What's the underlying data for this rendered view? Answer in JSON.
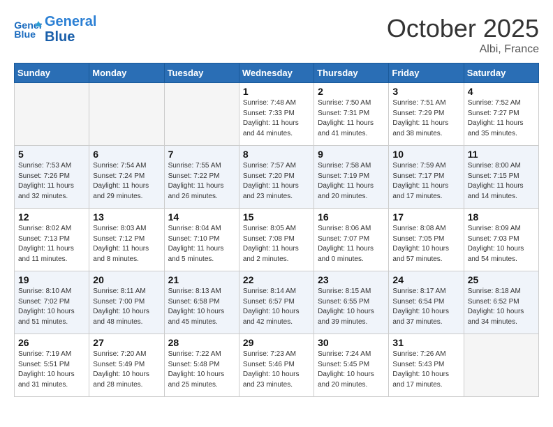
{
  "header": {
    "logo_line1": "General",
    "logo_line2": "Blue",
    "month_title": "October 2025",
    "location": "Albi, France"
  },
  "weekdays": [
    "Sunday",
    "Monday",
    "Tuesday",
    "Wednesday",
    "Thursday",
    "Friday",
    "Saturday"
  ],
  "weeks": [
    [
      {
        "day": "",
        "empty": true
      },
      {
        "day": "",
        "empty": true
      },
      {
        "day": "",
        "empty": true
      },
      {
        "day": "1",
        "sunrise": "7:48 AM",
        "sunset": "7:33 PM",
        "daylight": "11 hours and 44 minutes."
      },
      {
        "day": "2",
        "sunrise": "7:50 AM",
        "sunset": "7:31 PM",
        "daylight": "11 hours and 41 minutes."
      },
      {
        "day": "3",
        "sunrise": "7:51 AM",
        "sunset": "7:29 PM",
        "daylight": "11 hours and 38 minutes."
      },
      {
        "day": "4",
        "sunrise": "7:52 AM",
        "sunset": "7:27 PM",
        "daylight": "11 hours and 35 minutes."
      }
    ],
    [
      {
        "day": "5",
        "sunrise": "7:53 AM",
        "sunset": "7:26 PM",
        "daylight": "11 hours and 32 minutes."
      },
      {
        "day": "6",
        "sunrise": "7:54 AM",
        "sunset": "7:24 PM",
        "daylight": "11 hours and 29 minutes."
      },
      {
        "day": "7",
        "sunrise": "7:55 AM",
        "sunset": "7:22 PM",
        "daylight": "11 hours and 26 minutes."
      },
      {
        "day": "8",
        "sunrise": "7:57 AM",
        "sunset": "7:20 PM",
        "daylight": "11 hours and 23 minutes."
      },
      {
        "day": "9",
        "sunrise": "7:58 AM",
        "sunset": "7:19 PM",
        "daylight": "11 hours and 20 minutes."
      },
      {
        "day": "10",
        "sunrise": "7:59 AM",
        "sunset": "7:17 PM",
        "daylight": "11 hours and 17 minutes."
      },
      {
        "day": "11",
        "sunrise": "8:00 AM",
        "sunset": "7:15 PM",
        "daylight": "11 hours and 14 minutes."
      }
    ],
    [
      {
        "day": "12",
        "sunrise": "8:02 AM",
        "sunset": "7:13 PM",
        "daylight": "11 hours and 11 minutes."
      },
      {
        "day": "13",
        "sunrise": "8:03 AM",
        "sunset": "7:12 PM",
        "daylight": "11 hours and 8 minutes."
      },
      {
        "day": "14",
        "sunrise": "8:04 AM",
        "sunset": "7:10 PM",
        "daylight": "11 hours and 5 minutes."
      },
      {
        "day": "15",
        "sunrise": "8:05 AM",
        "sunset": "7:08 PM",
        "daylight": "11 hours and 2 minutes."
      },
      {
        "day": "16",
        "sunrise": "8:06 AM",
        "sunset": "7:07 PM",
        "daylight": "11 hours and 0 minutes."
      },
      {
        "day": "17",
        "sunrise": "8:08 AM",
        "sunset": "7:05 PM",
        "daylight": "10 hours and 57 minutes."
      },
      {
        "day": "18",
        "sunrise": "8:09 AM",
        "sunset": "7:03 PM",
        "daylight": "10 hours and 54 minutes."
      }
    ],
    [
      {
        "day": "19",
        "sunrise": "8:10 AM",
        "sunset": "7:02 PM",
        "daylight": "10 hours and 51 minutes."
      },
      {
        "day": "20",
        "sunrise": "8:11 AM",
        "sunset": "7:00 PM",
        "daylight": "10 hours and 48 minutes."
      },
      {
        "day": "21",
        "sunrise": "8:13 AM",
        "sunset": "6:58 PM",
        "daylight": "10 hours and 45 minutes."
      },
      {
        "day": "22",
        "sunrise": "8:14 AM",
        "sunset": "6:57 PM",
        "daylight": "10 hours and 42 minutes."
      },
      {
        "day": "23",
        "sunrise": "8:15 AM",
        "sunset": "6:55 PM",
        "daylight": "10 hours and 39 minutes."
      },
      {
        "day": "24",
        "sunrise": "8:17 AM",
        "sunset": "6:54 PM",
        "daylight": "10 hours and 37 minutes."
      },
      {
        "day": "25",
        "sunrise": "8:18 AM",
        "sunset": "6:52 PM",
        "daylight": "10 hours and 34 minutes."
      }
    ],
    [
      {
        "day": "26",
        "sunrise": "7:19 AM",
        "sunset": "5:51 PM",
        "daylight": "10 hours and 31 minutes."
      },
      {
        "day": "27",
        "sunrise": "7:20 AM",
        "sunset": "5:49 PM",
        "daylight": "10 hours and 28 minutes."
      },
      {
        "day": "28",
        "sunrise": "7:22 AM",
        "sunset": "5:48 PM",
        "daylight": "10 hours and 25 minutes."
      },
      {
        "day": "29",
        "sunrise": "7:23 AM",
        "sunset": "5:46 PM",
        "daylight": "10 hours and 23 minutes."
      },
      {
        "day": "30",
        "sunrise": "7:24 AM",
        "sunset": "5:45 PM",
        "daylight": "10 hours and 20 minutes."
      },
      {
        "day": "31",
        "sunrise": "7:26 AM",
        "sunset": "5:43 PM",
        "daylight": "10 hours and 17 minutes."
      },
      {
        "day": "",
        "empty": true
      }
    ]
  ]
}
